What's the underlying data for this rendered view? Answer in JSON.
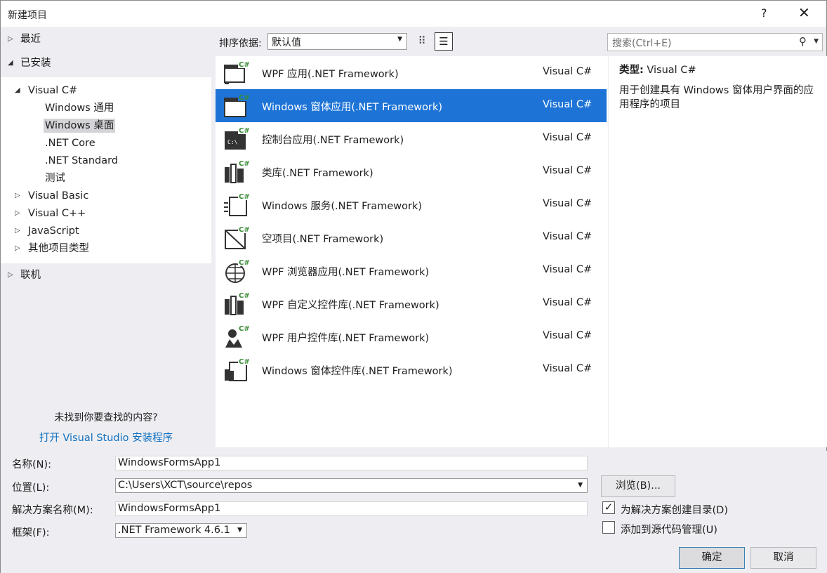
{
  "window": {
    "title": "新建项目",
    "help": "?",
    "close": "✕"
  },
  "tree": {
    "recent": "最近",
    "installed": "已安装",
    "visual_csharp": "Visual C#",
    "children": [
      "Windows 通用",
      "Windows 桌面",
      ".NET Core",
      ".NET Standard",
      "测试"
    ],
    "visual_basic": "Visual Basic",
    "visual_cpp": "Visual C++",
    "javascript": "JavaScript",
    "other": "其他项目类型",
    "online": "联机"
  },
  "help_text": {
    "not_found": "未找到你要查找的内容?",
    "installer_link": "打开 Visual Studio 安装程序"
  },
  "sort": {
    "label": "排序依据:",
    "value": "默认值"
  },
  "search": {
    "placeholder": "搜索(Ctrl+E)"
  },
  "templates": [
    {
      "name": "WPF 应用(.NET Framework)",
      "lang": "Visual C#",
      "icon": "wpf-app-icon"
    },
    {
      "name": "Windows 窗体应用(.NET Framework)",
      "lang": "Visual C#",
      "icon": "winforms-app-icon"
    },
    {
      "name": "控制台应用(.NET Framework)",
      "lang": "Visual C#",
      "icon": "console-app-icon"
    },
    {
      "name": "类库(.NET Framework)",
      "lang": "Visual C#",
      "icon": "class-library-icon"
    },
    {
      "name": "Windows 服务(.NET Framework)",
      "lang": "Visual C#",
      "icon": "windows-service-icon"
    },
    {
      "name": "空项目(.NET Framework)",
      "lang": "Visual C#",
      "icon": "empty-project-icon"
    },
    {
      "name": "WPF 浏览器应用(.NET Framework)",
      "lang": "Visual C#",
      "icon": "wpf-browser-app-icon"
    },
    {
      "name": "WPF 自定义控件库(.NET Framework)",
      "lang": "Visual C#",
      "icon": "wpf-custom-control-icon"
    },
    {
      "name": "WPF 用户控件库(.NET Framework)",
      "lang": "Visual C#",
      "icon": "wpf-user-control-icon"
    },
    {
      "name": "Windows 窗体控件库(.NET Framework)",
      "lang": "Visual C#",
      "icon": "winforms-control-library-icon"
    }
  ],
  "description": {
    "type_label": "类型:",
    "type_value": "Visual C#",
    "text": "用于创建具有 Windows 窗体用户界面的应用程序的项目"
  },
  "form": {
    "name_label": "名称(N):",
    "name_value": "WindowsFormsApp1",
    "location_label": "位置(L):",
    "location_value": "C:\\Users\\XCT\\source\\repos",
    "solution_label": "解决方案名称(M):",
    "solution_value": "WindowsFormsApp1",
    "framework_label": "框架(F):",
    "framework_value": ".NET Framework 4.6.1",
    "browse": "浏览(B)...",
    "create_dir_label": "为解决方案创建目录(D)",
    "create_dir_checked": true,
    "source_control_label": "添加到源代码管理(U)",
    "source_control_checked": false,
    "ok": "确定",
    "cancel": "取消"
  },
  "colors": {
    "selection": "#1e74d6",
    "link": "#0e70c0",
    "csharp_badge": "#388a34"
  }
}
